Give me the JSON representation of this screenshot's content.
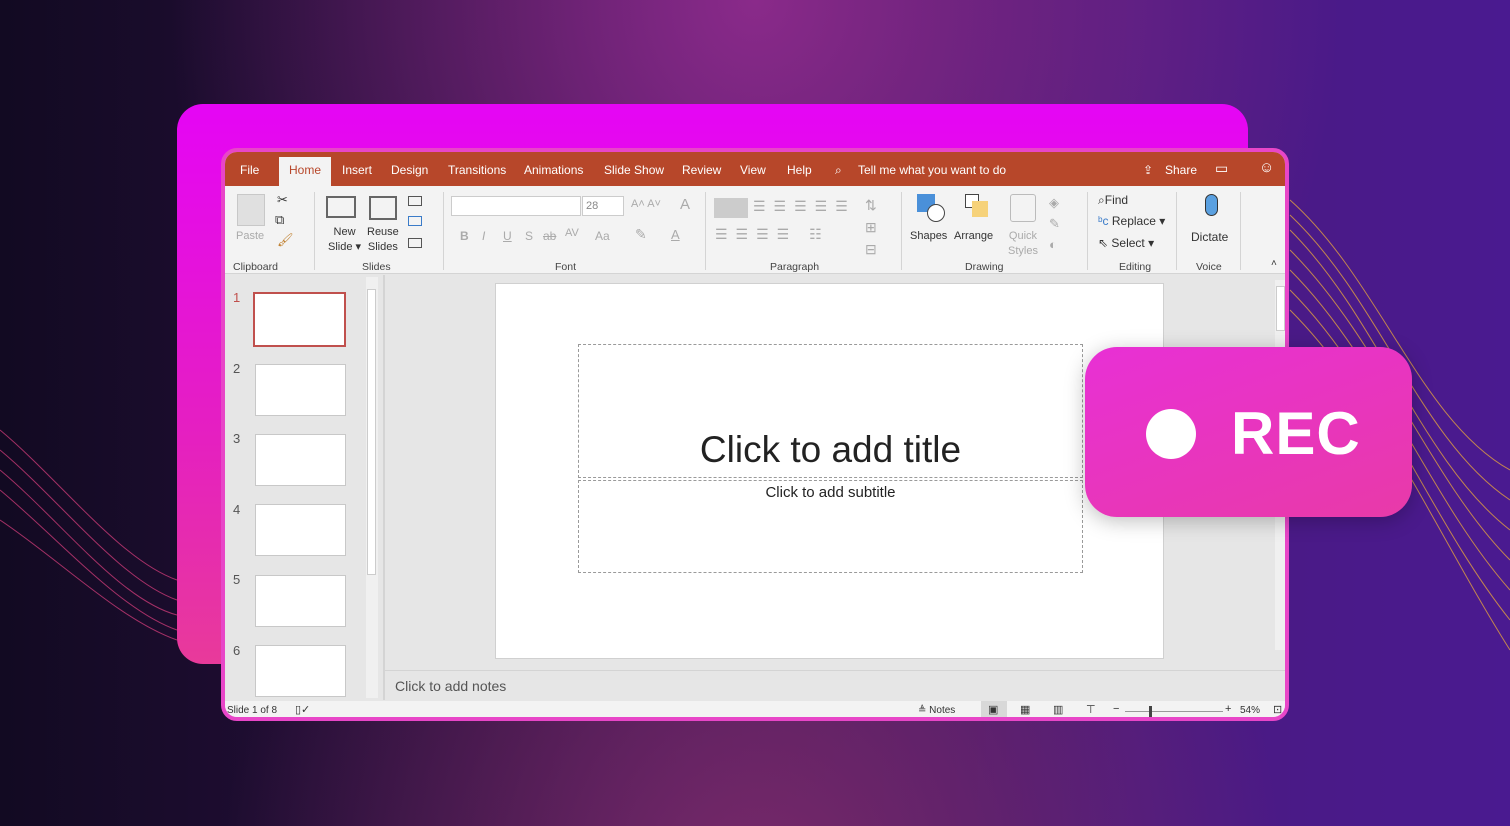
{
  "tabs": {
    "file": "File",
    "home": "Home",
    "insert": "Insert",
    "design": "Design",
    "transitions": "Transitions",
    "animations": "Animations",
    "slideshow": "Slide Show",
    "review": "Review",
    "view": "View",
    "help": "Help",
    "tellme": "Tell me what you want to do",
    "share": "Share"
  },
  "ribbon": {
    "clipboard": {
      "paste": "Paste",
      "label": "Clipboard"
    },
    "slides": {
      "new_slide": [
        "New",
        "Slide"
      ],
      "reuse_slides": [
        "Reuse",
        "Slides"
      ],
      "label": "Slides"
    },
    "font": {
      "font_name": "",
      "font_size": "28",
      "bold": "B",
      "italic": "I",
      "underline": "U",
      "shadow": "S",
      "strike": "ab",
      "spacing": "AV",
      "case": "Aa",
      "color": "A",
      "label": "Font"
    },
    "paragraph": {
      "label": "Paragraph"
    },
    "drawing": {
      "shapes": "Shapes",
      "arrange": "Arrange",
      "quick_styles": [
        "Quick",
        "Styles"
      ],
      "label": "Drawing"
    },
    "editing": {
      "find": "Find",
      "replace": "Replace",
      "select": "Select",
      "label": "Editing"
    },
    "voice": {
      "dictate": "Dictate",
      "label": "Voice"
    }
  },
  "thumbnails": [
    "1",
    "2",
    "3",
    "4",
    "5",
    "6"
  ],
  "slide": {
    "title_placeholder": "Click to add title",
    "subtitle_placeholder": "Click to add subtitle"
  },
  "notes": {
    "placeholder": "Click to add notes"
  },
  "status": {
    "slide_count": "Slide 1 of 8",
    "notes": "Notes",
    "zoom": "54%"
  },
  "badge": {
    "text": "REC"
  },
  "colors": {
    "tab_bar": "#b7472a",
    "frame": "#e846c8",
    "badge": "#e830d5"
  }
}
